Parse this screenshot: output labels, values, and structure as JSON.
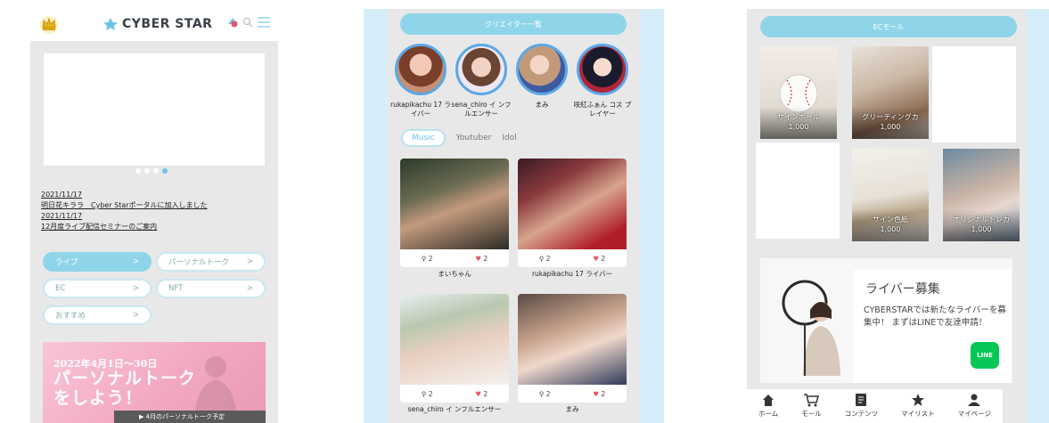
{
  "panel1": {
    "logo_text": "CYBER STAR",
    "news": [
      {
        "date": "2021/11/17",
        "title": "明日花キララ　Cyber Starポータルに加入しました"
      },
      {
        "date": "2021/11/17",
        "title": "12月度ライブ配信セミナーのご案内"
      }
    ],
    "menu": [
      {
        "label": "ライブ",
        "arrow": ">"
      },
      {
        "label": "パーソナルトーク",
        "arrow": ">"
      },
      {
        "label": "EC",
        "arrow": ">"
      },
      {
        "label": "NFT",
        "arrow": ">"
      },
      {
        "label": "おすすめ",
        "arrow": ">"
      }
    ],
    "promo": {
      "date": "2022年4月1日～30日",
      "title_line1": "パーソナルトーク",
      "title_line2": "をしよう！",
      "link": "▶ 4月のパーソナルトーク予定"
    }
  },
  "panel2": {
    "section_title": "クリエイター一覧",
    "creators": [
      {
        "name": "rukapikachu 17 ライバー"
      },
      {
        "name": "sena_chiro イ ンフルエンサー"
      },
      {
        "name": "まみ"
      },
      {
        "name": "咲紅ふぁん コス プレイヤー"
      }
    ],
    "tabs": [
      "Music",
      "Youtuber",
      "Idol"
    ],
    "cards": [
      {
        "followers": "2",
        "likes": "2",
        "caption": "まいちゃん"
      },
      {
        "followers": "2",
        "likes": "2",
        "caption": "rukapikachu 17 ライバー"
      },
      {
        "followers": "2",
        "likes": "2",
        "caption": "sena_chiro イ ンフルエンサー"
      },
      {
        "followers": "2",
        "likes": "2",
        "caption": "まみ"
      }
    ]
  },
  "panel3": {
    "section_title": "ECモール",
    "products": [
      {
        "name": "サインボール",
        "price": "1,000"
      },
      {
        "name": "グリーティングカ",
        "price": "1,000"
      },
      {
        "name": "サイン色紙",
        "price": "1,000"
      },
      {
        "name": "オリジナルトレカ",
        "price": "1,000"
      }
    ],
    "recruit": {
      "title": "ライバー募集",
      "text": "CYBERSTARでは新たなライバーを募集中！ まずはLINEで友達申請！",
      "line_label": "LINE"
    },
    "nav": [
      "ホーム",
      "モール",
      "コンテンツ",
      "マイリスト",
      "マイページ"
    ]
  },
  "colors": {
    "accent": "#8fd5ea",
    "frame": "#d6eef9",
    "like": "#e8546a"
  }
}
